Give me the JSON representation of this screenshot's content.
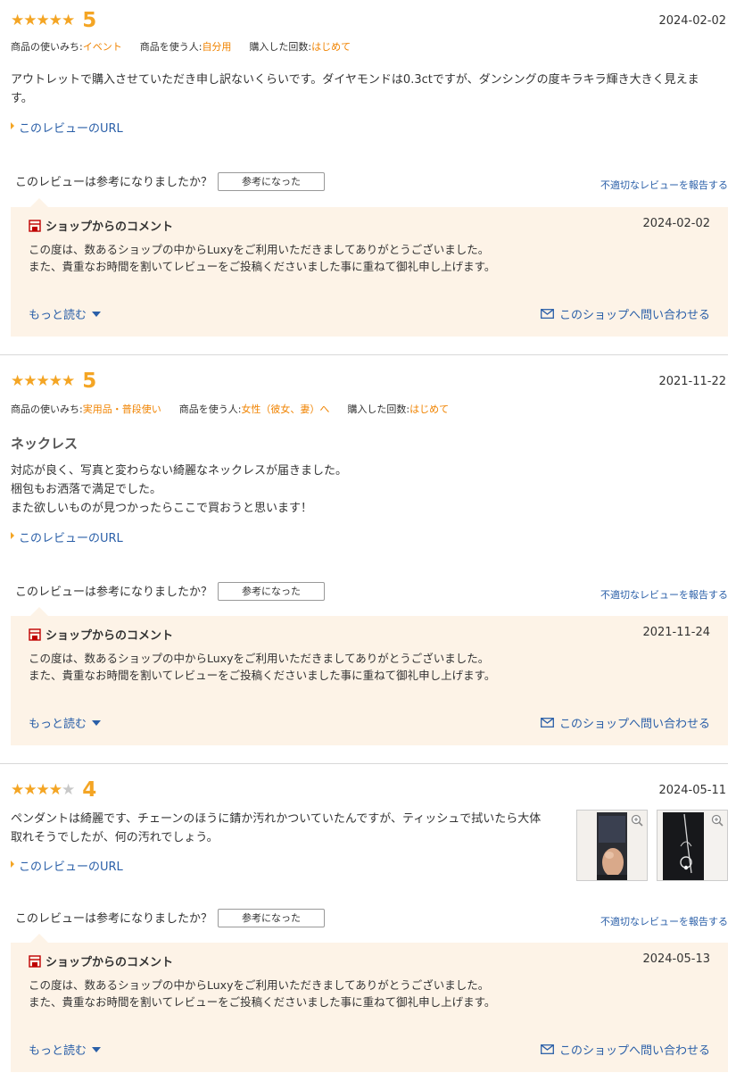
{
  "common": {
    "url_label": "このレビューのURL",
    "helpful_question": "このレビューは参考になりましたか？",
    "helpful_button": "参考になった",
    "report_label": "不適切なレビューを報告する",
    "shop_comment_title": "ショップからのコメント",
    "more_label": "もっと読む",
    "contact_label": "このショップへ問い合わせる",
    "usage_label": "商品の使いみち:",
    "user_label": "商品を使う人:",
    "count_label": "購入した回数:"
  },
  "colors": {
    "star": "#f4a524",
    "star_off": "#c8c8c8",
    "accent": "#f08300",
    "link": "#2a5fa8",
    "shop_bg": "#fdf3e7",
    "shop_icon": "#bf0000"
  },
  "reviews": [
    {
      "stars": "★★★★★",
      "stars_off": "",
      "rating": "5",
      "date": "2024-02-02",
      "usage": "イベント",
      "user": "自分用",
      "count": "はじめて",
      "title": "",
      "body": [
        "アウトレットで購入させていただき申し訳ないくらいです。ダイヤモンドは0.3ctですが、ダンシングの度キラキラ輝き大きく見えま",
        "す。"
      ],
      "shop": {
        "date": "2024-02-02",
        "body": [
          "この度は、数あるショップの中からLuxyをご利用いただきましてありがとうございました。",
          "また、貴重なお時間を割いてレビューをご投稿くださいました事に重ねて御礼申し上げます。"
        ]
      }
    },
    {
      "stars": "★★★★★",
      "stars_off": "",
      "rating": "5",
      "date": "2021-11-22",
      "usage": "実用品・普段使い",
      "user": "女性（彼女、妻）へ",
      "count": "はじめて",
      "title": "ネックレス",
      "body": [
        "対応が良く、写真と変わらない綺麗なネックレスが届きました。",
        "梱包もお洒落で満足でした。",
        "また欲しいものが見つかったらここで買おうと思います！"
      ],
      "shop": {
        "date": "2021-11-24",
        "body": [
          "この度は、数あるショップの中からLuxyをご利用いただきましてありがとうございました。",
          "また、貴重なお時間を割いてレビューをご投稿くださいました事に重ねて御礼申し上げます。"
        ]
      }
    },
    {
      "stars": "★★★★",
      "stars_off": "★",
      "rating": "4",
      "date": "2024-05-11",
      "title": "",
      "body": [
        "ペンダントは綺麗です、チェーンのほうに錆か汚れかついていたんですが、ティッシュで拭いたら大体",
        "取れそうでしたが、何の汚れでしょう。"
      ],
      "shop": {
        "date": "2024-05-13",
        "body": [
          "この度は、数あるショップの中からLuxyをご利用いただきましてありがとうございました。",
          "また、貴重なお時間を割いてレビューをご投稿くださいました事に重ねて御礼申し上げます。"
        ]
      }
    }
  ]
}
